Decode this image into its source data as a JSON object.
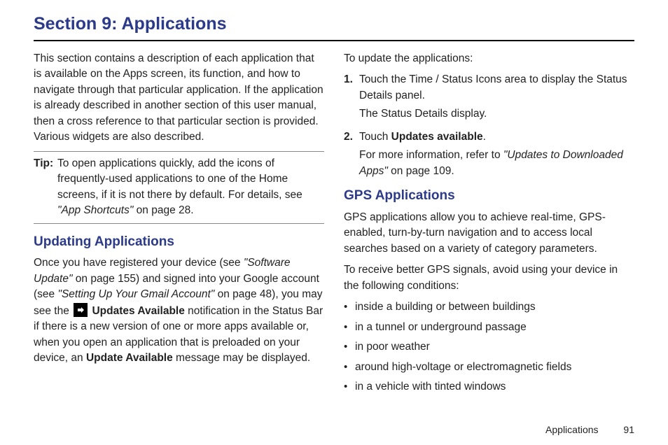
{
  "title": "Section 9: Applications",
  "col1": {
    "intro": "This section contains a description of each application that is available on the Apps screen, its function, and how to navigate through that particular application. If the application is already described in another section of this user manual, then a cross reference to that particular section is provided. Various widgets are also described.",
    "tip_label": "Tip:",
    "tip_pre": "To open applications quickly, add the icons of frequently-used applications to one of the Home screens, if it is not there by default. For details, see ",
    "tip_ref": "\"App Shortcuts\"",
    "tip_post": " on page 28.",
    "h2_updating": "Updating Applications",
    "upd_pre1": "Once you have registered your device (see ",
    "upd_ref1": "\"Software Update\"",
    "upd_mid1": " on page 155) and signed into your Google account (see ",
    "upd_ref2": "\"Setting Up Your Gmail Account\"",
    "upd_mid2": " on page 48), you may see the ",
    "upd_bold1": "Updates Available",
    "upd_mid3": " notification in the Status Bar if there is a new version of one or more apps available or, when you open an application that is preloaded on your device, an ",
    "upd_bold2": "Update Available",
    "upd_post": " message may be displayed."
  },
  "col2": {
    "lead": "To update the applications:",
    "step1_num": "1.",
    "step1a": "Touch the Time / Status Icons area to display the Status Details panel.",
    "step1b": "The Status Details display.",
    "step2_num": "2.",
    "step2a_pre": "Touch ",
    "step2a_bold": "Updates available",
    "step2a_post": ".",
    "step2b_pre": "For more information, refer to ",
    "step2b_ref": "\"Updates to Downloaded Apps\"",
    "step2b_post": " on page 109.",
    "h2_gps": "GPS Applications",
    "gps_para1": "GPS applications allow you to achieve real-time, GPS-enabled, turn-by-turn navigation and to access local searches based on a variety of category parameters.",
    "gps_para2": "To receive better GPS signals, avoid using your device in the following conditions:",
    "bullets": [
      "inside a building or between buildings",
      "in a tunnel or underground passage",
      "in poor weather",
      "around high-voltage or electromagnetic fields",
      "in a vehicle with tinted windows"
    ]
  },
  "footer": {
    "section": "Applications",
    "page": "91"
  }
}
